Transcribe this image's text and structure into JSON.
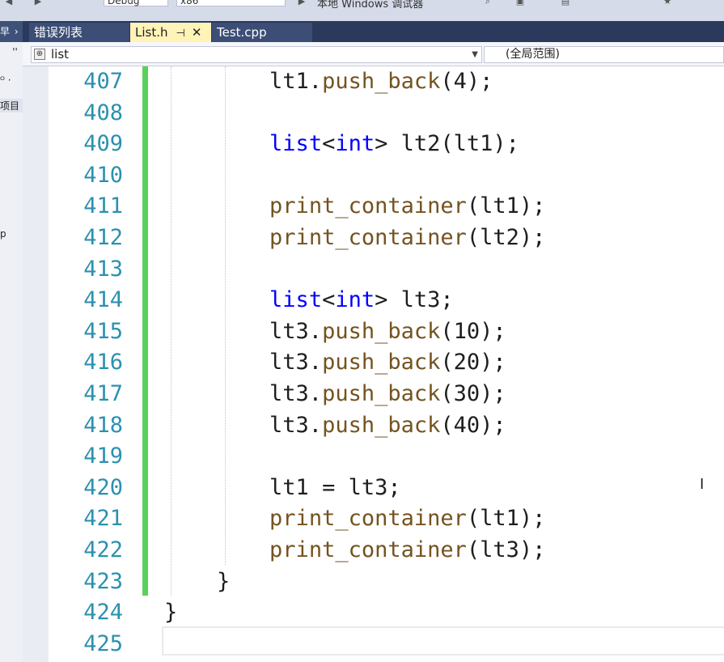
{
  "toolbar": {
    "config": "Debug",
    "platform": "x86",
    "run_label": "本地 Windows 调试器"
  },
  "left_panel": {
    "header": "早",
    "row1": "ᴼ ·",
    "row2": "项目",
    "row3": "p"
  },
  "tabs": [
    {
      "label": "错误列表",
      "active": false
    },
    {
      "label": "List.h",
      "active": true,
      "pin": "⊣",
      "close": "✕"
    },
    {
      "label": "Test.cpp",
      "active": false
    }
  ],
  "navbar": {
    "scope_left": "list",
    "scope_right": "(全局范围)"
  },
  "editor": {
    "lines": [
      {
        "n": "407",
        "code": [
          [
            "id",
            "        lt1."
          ],
          [
            "fn",
            "push_back"
          ],
          [
            "id",
            "(4);"
          ]
        ]
      },
      {
        "n": "408",
        "code": []
      },
      {
        "n": "409",
        "code": [
          [
            "id",
            "        "
          ],
          [
            "kw",
            "list"
          ],
          [
            "id",
            "<"
          ],
          [
            "kw",
            "int"
          ],
          [
            "id",
            "> lt2(lt1);"
          ]
        ]
      },
      {
        "n": "410",
        "code": []
      },
      {
        "n": "411",
        "code": [
          [
            "id",
            "        "
          ],
          [
            "fn",
            "print_container"
          ],
          [
            "id",
            "(lt1);"
          ]
        ]
      },
      {
        "n": "412",
        "code": [
          [
            "id",
            "        "
          ],
          [
            "fn",
            "print_container"
          ],
          [
            "id",
            "(lt2);"
          ]
        ]
      },
      {
        "n": "413",
        "code": []
      },
      {
        "n": "414",
        "code": [
          [
            "id",
            "        "
          ],
          [
            "kw",
            "list"
          ],
          [
            "id",
            "<"
          ],
          [
            "kw",
            "int"
          ],
          [
            "id",
            "> lt3;"
          ]
        ]
      },
      {
        "n": "415",
        "code": [
          [
            "id",
            "        lt3."
          ],
          [
            "fn",
            "push_back"
          ],
          [
            "id",
            "(10);"
          ]
        ]
      },
      {
        "n": "416",
        "code": [
          [
            "id",
            "        lt3."
          ],
          [
            "fn",
            "push_back"
          ],
          [
            "id",
            "(20);"
          ]
        ]
      },
      {
        "n": "417",
        "code": [
          [
            "id",
            "        lt3."
          ],
          [
            "fn",
            "push_back"
          ],
          [
            "id",
            "(30);"
          ]
        ]
      },
      {
        "n": "418",
        "code": [
          [
            "id",
            "        lt3."
          ],
          [
            "fn",
            "push_back"
          ],
          [
            "id",
            "(40);"
          ]
        ]
      },
      {
        "n": "419",
        "code": []
      },
      {
        "n": "420",
        "code": [
          [
            "id",
            "        lt1 = lt3;"
          ]
        ]
      },
      {
        "n": "421",
        "code": [
          [
            "id",
            "        "
          ],
          [
            "fn",
            "print_container"
          ],
          [
            "id",
            "(lt1);"
          ]
        ]
      },
      {
        "n": "422",
        "code": [
          [
            "id",
            "        "
          ],
          [
            "fn",
            "print_container"
          ],
          [
            "id",
            "(lt3);"
          ]
        ]
      },
      {
        "n": "423",
        "code": [
          [
            "id",
            "    }"
          ]
        ]
      },
      {
        "n": "424",
        "code": [
          [
            "id",
            "}"
          ]
        ]
      },
      {
        "n": "425",
        "code": []
      }
    ]
  },
  "colors": {
    "keyword": "#0000ff",
    "function": "#74531f",
    "line_number": "#2b91af",
    "change_bar": "#5bd15b",
    "active_tab": "#fff3b8"
  }
}
